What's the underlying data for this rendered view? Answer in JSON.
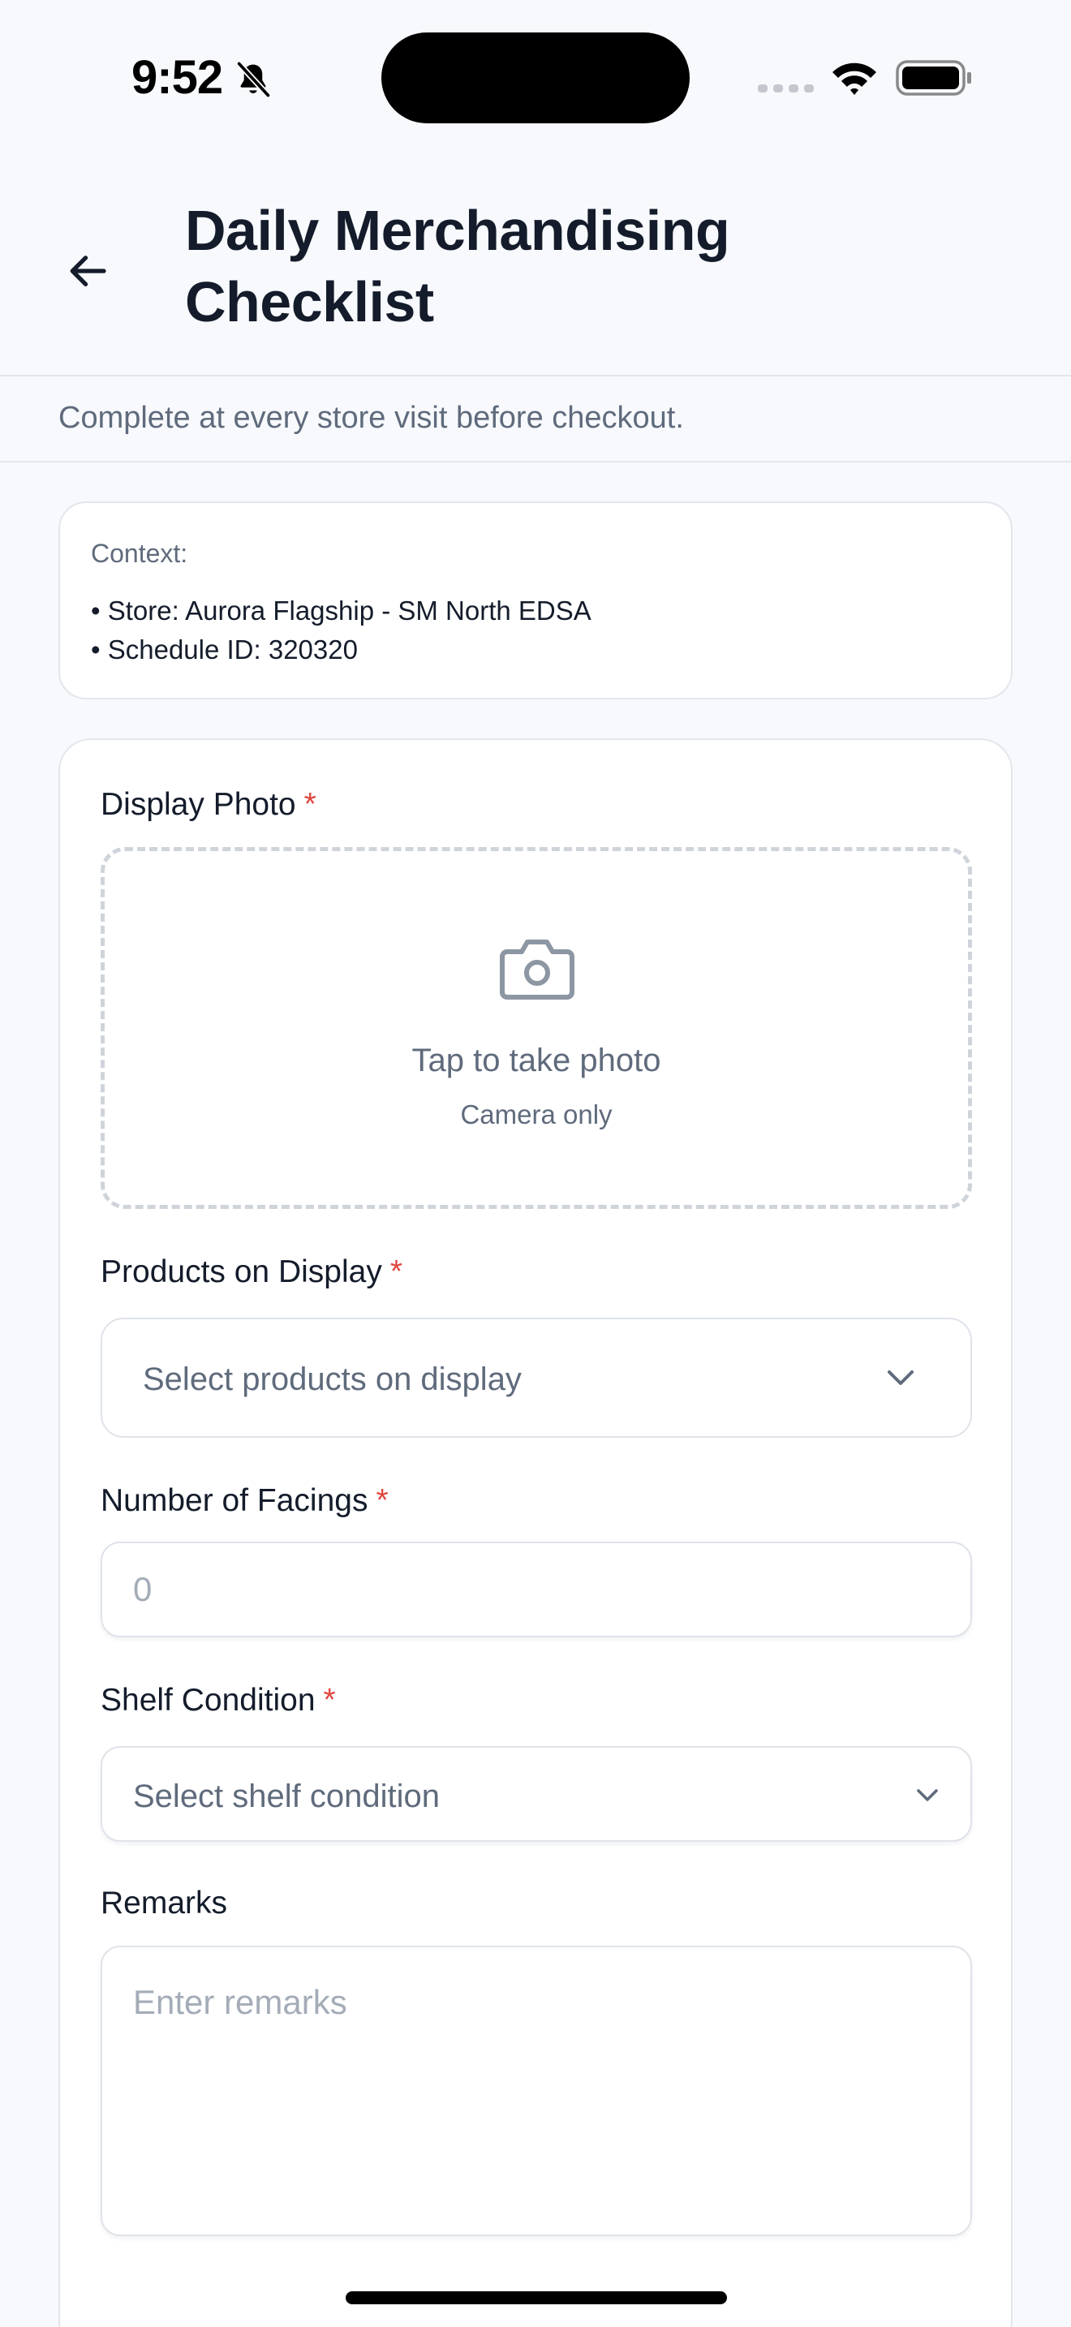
{
  "status_bar": {
    "time": "9:52",
    "icons": [
      "bell-slash-icon",
      "cellular-signal-icon",
      "wifi-icon",
      "battery-icon"
    ]
  },
  "header": {
    "back_icon": "arrow-left-icon",
    "title": "Daily Merchandising Checklist",
    "subtitle": "Complete at every store visit before checkout."
  },
  "context": {
    "label": "Context:",
    "lines": [
      "• Store: Aurora Flagship - SM North EDSA",
      "• Schedule ID: 320320"
    ]
  },
  "form": {
    "display_photo": {
      "label": "Display Photo",
      "required_mark": "*",
      "icon": "camera-icon",
      "title": "Tap to take photo",
      "hint": "Camera only"
    },
    "products_on_display": {
      "label": "Products on Display",
      "required_mark": "*",
      "placeholder": "Select products on display",
      "icon": "chevron-down-icon"
    },
    "number_of_facings": {
      "label": "Number of Facings",
      "required_mark": "*",
      "placeholder": "0"
    },
    "shelf_condition": {
      "label": "Shelf Condition",
      "required_mark": "*",
      "placeholder": "Select shelf condition",
      "icon": "chevron-down-icon"
    },
    "remarks": {
      "label": "Remarks",
      "placeholder": "Enter remarks"
    }
  },
  "colors": {
    "background": "#f7f9fc",
    "card": "#ffffff",
    "border": "#e2e6ec",
    "text_primary": "#141c2b",
    "text_secondary": "#5f6b7c",
    "placeholder": "#a4acb8",
    "required": "#e0463f"
  }
}
